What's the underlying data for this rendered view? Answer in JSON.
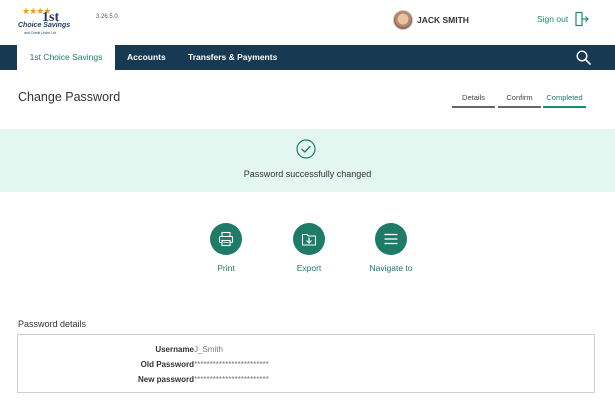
{
  "header": {
    "logo": {
      "stars": "★★★★",
      "numeral": "1st",
      "name": "Choice Savings",
      "tagline": "and Credit Union Ltd."
    },
    "version": "3.26.5.0",
    "user_name": "JACK SMITH",
    "signout_label": "Sign out"
  },
  "nav": {
    "items": [
      {
        "label": "1st Choice Savings",
        "active": true
      },
      {
        "label": "Accounts",
        "active": false
      },
      {
        "label": "Transfers & Payments",
        "active": false
      }
    ]
  },
  "page": {
    "title": "Change Password",
    "steps": [
      {
        "label": "Details",
        "active": false
      },
      {
        "label": "Confirm",
        "active": false
      },
      {
        "label": "Completed",
        "active": true
      }
    ]
  },
  "banner": {
    "message": "Password successfully changed"
  },
  "actions": [
    {
      "label": "Print",
      "icon": "printer-icon"
    },
    {
      "label": "Export",
      "icon": "export-icon"
    },
    {
      "label": "Navigate to",
      "icon": "menu-icon"
    }
  ],
  "details": {
    "title": "Password details",
    "rows": [
      {
        "label": "Username",
        "value": "J_Smith"
      },
      {
        "label": "Old Password",
        "value": "************************"
      },
      {
        "label": "New password",
        "value": "************************"
      }
    ]
  },
  "colors": {
    "nav_bg": "#173a52",
    "accent": "#1f8a6e",
    "action_bg": "#1d7b68",
    "banner_bg": "#e3f6ef"
  }
}
